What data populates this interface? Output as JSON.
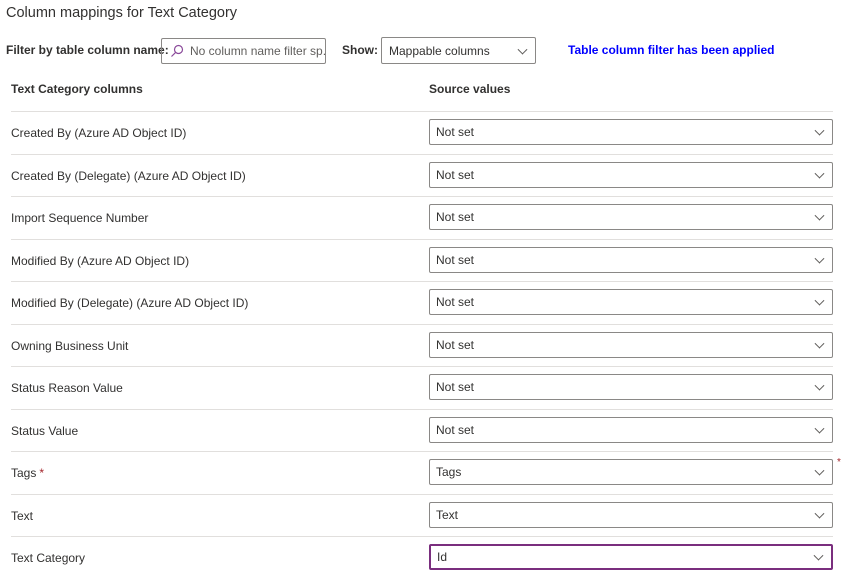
{
  "title": "Column mappings for Text Category",
  "filter": {
    "label": "Filter by table column name:",
    "placeholder": "No column name filter sp...",
    "search_icon": "search-icon"
  },
  "show": {
    "label": "Show:",
    "value": "Mappable columns"
  },
  "status": {
    "text": "Table column filter has been applied",
    "color": "#0000ff"
  },
  "table": {
    "headers": [
      "Text Category columns",
      "Source values"
    ],
    "rows": [
      {
        "label": "Created By (Azure AD Object ID)",
        "value": "Not set"
      },
      {
        "label": "Created By (Delegate) (Azure AD Object ID)",
        "value": "Not set"
      },
      {
        "label": "Import Sequence Number",
        "value": "Not set"
      },
      {
        "label": "Modified By (Azure AD Object ID)",
        "value": "Not set"
      },
      {
        "label": "Modified By (Delegate) (Azure AD Object ID)",
        "value": "Not set"
      },
      {
        "label": "Owning Business Unit",
        "value": "Not set"
      },
      {
        "label": "Status Reason Value",
        "value": "Not set"
      },
      {
        "label": "Status Value",
        "value": "Not set"
      },
      {
        "label": "Tags",
        "value": "Tags",
        "required": true,
        "required_mark": "*"
      },
      {
        "label": "Text",
        "value": "Text"
      },
      {
        "label": "Text Category",
        "value": "Id",
        "focused": true
      }
    ]
  }
}
